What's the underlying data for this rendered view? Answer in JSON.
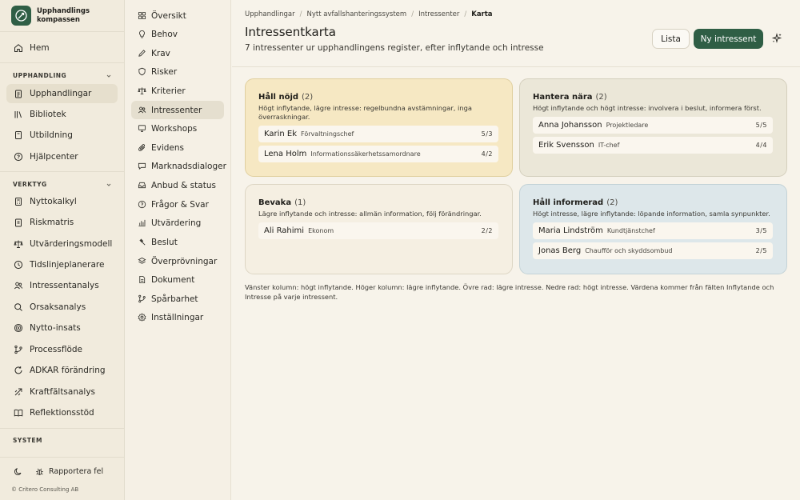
{
  "brand": {
    "name": "Upphandlings kompassen",
    "name_line1": "Upphandlings",
    "name_line2": "kompassen"
  },
  "sidebar": {
    "home": "Hem",
    "section_upphandling": "UPPHANDLING",
    "upphandling_items": [
      "Upphandlingar",
      "Bibliotek",
      "Utbildning",
      "Hjälpcenter"
    ],
    "section_verktyg": "VERKTYG",
    "verktyg_items": [
      "Nyttokalkyl",
      "Riskmatris",
      "Utvärderingsmodell",
      "Tidslinjeplanerare",
      "Intressentanalys",
      "Orsaksanalys",
      "Nytto-insats",
      "Processflöde",
      "ADKAR förändring",
      "Kraftfältsanalys",
      "Reflektionsstöd"
    ],
    "section_system": "SYSTEM",
    "report_label": "Rapportera fel",
    "copyright": "© Critero Consulting AB"
  },
  "subnav": {
    "items": [
      "Översikt",
      "Behov",
      "Krav",
      "Risker",
      "Kriterier",
      "Intressenter",
      "Workshops",
      "Evidens",
      "Marknadsdialoger",
      "Anbud & status",
      "Frågor & Svar",
      "Utvärdering",
      "Beslut",
      "Överprövningar",
      "Dokument",
      "Spårbarhet",
      "Inställningar"
    ],
    "active": "Intressenter"
  },
  "breadcrumb": {
    "items": [
      "Upphandlingar",
      "Nytt avfallshanteringssystem",
      "Intressenter"
    ],
    "current": "Karta",
    "separator": "/"
  },
  "page": {
    "title": "Intressentkarta",
    "subtitle": "7 intressenter ur upphandlingens register, efter inflytande och intresse",
    "btn_list": "Lista",
    "btn_new": "Ny intressent"
  },
  "quadrants": [
    {
      "title": "Håll nöjd",
      "count": "(2)",
      "desc": "Högt inflytande, lägre intresse: regelbundna avstämningar, inga överraskningar.",
      "color": "#f6e8c3",
      "people": [
        {
          "name": "Karin Ek",
          "role": "Förvaltningschef",
          "score": "5/3"
        },
        {
          "name": "Lena Holm",
          "role": "Informationssäkerhetssamordnare",
          "score": "4/2"
        }
      ]
    },
    {
      "title": "Hantera nära",
      "count": "(2)",
      "desc": "Högt inflytande och högt intresse: involvera i beslut, informera först.",
      "color": "#ebe7d8",
      "people": [
        {
          "name": "Anna Johansson",
          "role": "Projektledare",
          "score": "5/5"
        },
        {
          "name": "Erik Svensson",
          "role": "IT-chef",
          "score": "4/4"
        }
      ]
    },
    {
      "title": "Bevaka",
      "count": "(1)",
      "desc": "Lägre inflytande och intresse: allmän information, följ förändringar.",
      "color": "#f5efe2",
      "people": [
        {
          "name": "Ali Rahimi",
          "role": "Ekonom",
          "score": "2/2"
        }
      ]
    },
    {
      "title": "Håll informerad",
      "count": "(2)",
      "desc": "Högt intresse, lägre inflytande: löpande information, samla synpunkter.",
      "color": "#dde7ea",
      "people": [
        {
          "name": "Maria Lindström",
          "role": "Kundtjänstchef",
          "score": "3/5"
        },
        {
          "name": "Jonas Berg",
          "role": "Chaufför och skyddsombud",
          "score": "2/5"
        }
      ]
    }
  ],
  "note": "Vänster kolumn: högt inflytande. Höger kolumn: lägre inflytande. Övre rad: lägre intresse. Nedre rad: högt intresse. Värdena kommer från fälten Inflytande och Intresse på varje intressent.",
  "colors": {
    "accent": "#2f5e45",
    "sidebar_bg": "#f1ebdd"
  }
}
